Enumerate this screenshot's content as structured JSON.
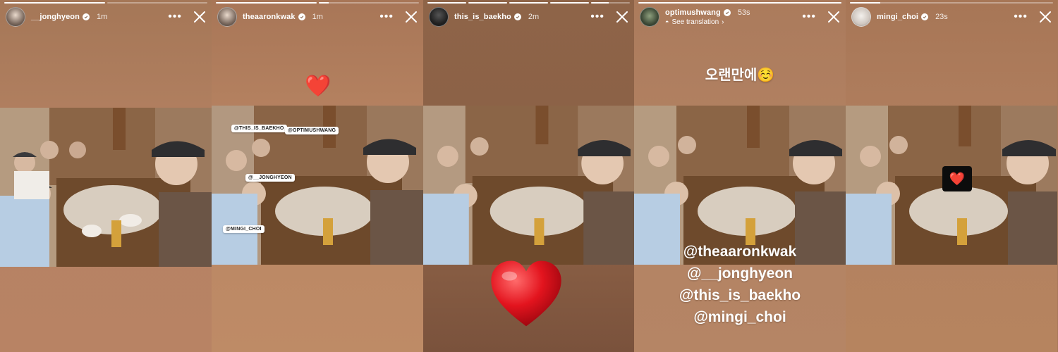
{
  "stories": [
    {
      "username": "__jonghyeon",
      "time": "1m",
      "progress": [
        1.0,
        0.0
      ],
      "more_label": "•••"
    },
    {
      "username": "theaaronkwak",
      "time": "1m",
      "progress": [
        1.0,
        0.1
      ],
      "more_label": "•••",
      "overlay_emoji": "❤️",
      "tags": [
        "@THIS_IS_BAEKHO",
        "@OPTIMUSHWANG",
        "@__JONGHYEON",
        "@MINGI_CHOI"
      ]
    },
    {
      "username": "this_is_baekho",
      "time": "2m",
      "progress": [
        1.0,
        1.0,
        1.0,
        1.0,
        0.45
      ],
      "more_label": "•••"
    },
    {
      "username": "optimushwang",
      "time": "53s",
      "progress": [
        1.0
      ],
      "more_label": "•••",
      "see_translation": "See translation",
      "caption": "오랜만에",
      "caption_emoji": "☺️",
      "mentions": [
        "@theaaronkwak",
        "@__jonghyeon",
        "@this_is_baekho",
        "@mingi_choi"
      ]
    },
    {
      "username": "mingi_choi",
      "time": "23s",
      "progress": [
        0.15
      ],
      "more_label": "•••",
      "overlay_emoji": "❤️"
    }
  ]
}
